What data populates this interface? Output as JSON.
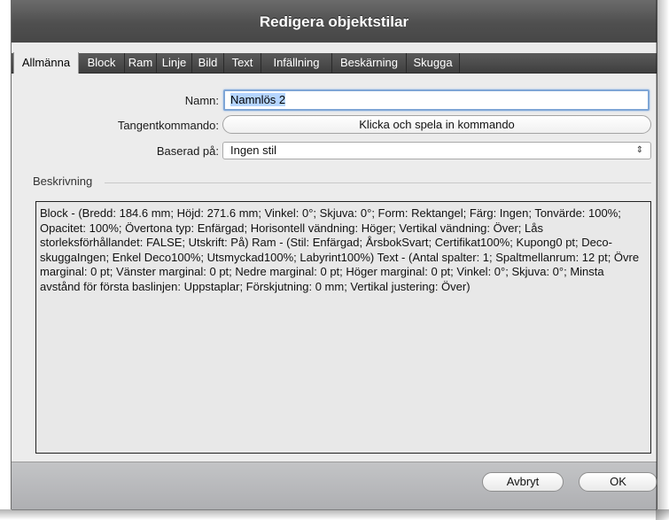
{
  "window": {
    "title": "Redigera objektstilar"
  },
  "tabs": [
    {
      "label": "Allmänna",
      "active": true
    },
    {
      "label": "Block"
    },
    {
      "label": "Ram"
    },
    {
      "label": "Linje"
    },
    {
      "label": "Bild"
    },
    {
      "label": "Text"
    },
    {
      "label": "Infällning"
    },
    {
      "label": "Beskärning"
    },
    {
      "label": "Skugga"
    }
  ],
  "form": {
    "name_label": "Namn:",
    "name_value": "Namnlös 2",
    "shortcut_label": "Tangentkommando:",
    "shortcut_button": "Klicka och spela in kommando",
    "based_on_label": "Baserad på:",
    "based_on_value": "Ingen stil"
  },
  "description": {
    "label": "Beskrivning",
    "text": "Block - (Bredd: 184.6 mm; Höjd: 271.6 mm; Vinkel: 0°; Skjuva: 0°; Form: Rektangel; Färg: Ingen; Tonvärde: 100%; Opacitet: 100%; Övertona typ: Enfärgad; Horisontell vändning: Höger; Vertikal vändning: Över; Lås storleksförhållandet: FALSE; Utskrift: På) Ram - (Stil: Enfärgad; ÅrsbokSvart; Certifikat100%; Kupong0 pt; Deco-skuggaIngen; Enkel Deco100%; Utsmyckad100%; Labyrint100%) Text - (Antal spalter: 1; Spaltmellanrum: 12 pt; Övre marginal: 0 pt; Vänster marginal: 0 pt; Nedre marginal: 0 pt; Höger  marginal: 0 pt; Vinkel: 0°; Skjuva: 0°; Minsta avstånd för första baslinjen: Uppstaplar; Förskjutning: 0 mm; Vertikal justering: Över)"
  },
  "buttons": {
    "cancel": "Avbryt",
    "ok": "OK"
  },
  "icons": {
    "select_arrows": "⇕"
  },
  "colors": {
    "titlebar": "#4f4f4f",
    "focus_ring": "#7fa6d6",
    "selection": "#b5d5ff"
  }
}
